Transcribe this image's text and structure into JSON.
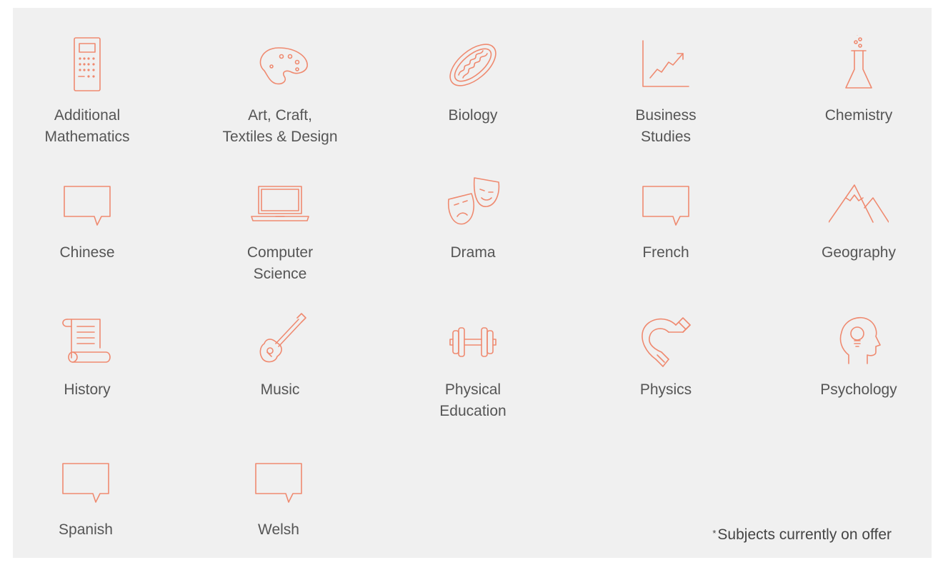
{
  "accent_color": "#ef8a70",
  "subjects": [
    {
      "label": "Additional\nMathematics",
      "icon": "calculator-icon"
    },
    {
      "label": "Art, Craft,\nTextiles & Design",
      "icon": "palette-icon"
    },
    {
      "label": "Biology",
      "icon": "mitochondria-icon"
    },
    {
      "label": "Business\nStudies",
      "icon": "line-graph-icon"
    },
    {
      "label": "Chemistry",
      "icon": "flask-icon"
    },
    {
      "label": "Chinese",
      "icon": "speech-bubble-icon"
    },
    {
      "label": "Computer\nScience",
      "icon": "laptop-icon"
    },
    {
      "label": "Drama",
      "icon": "theatre-masks-icon"
    },
    {
      "label": "French",
      "icon": "speech-bubble-icon"
    },
    {
      "label": "Geography",
      "icon": "mountains-icon"
    },
    {
      "label": "History",
      "icon": "scroll-icon"
    },
    {
      "label": "Music",
      "icon": "guitar-icon"
    },
    {
      "label": "Physical\nEducation",
      "icon": "dumbbell-icon"
    },
    {
      "label": "Physics",
      "icon": "magnet-icon"
    },
    {
      "label": "Psychology",
      "icon": "head-lightbulb-icon"
    },
    {
      "label": "Spanish",
      "icon": "speech-bubble-icon"
    },
    {
      "label": "Welsh",
      "icon": "speech-bubble-icon"
    }
  ],
  "footnote": {
    "star": "*",
    "text": "Subjects currently on offer"
  }
}
